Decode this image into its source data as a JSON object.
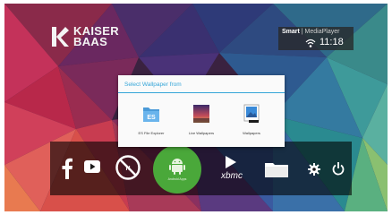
{
  "brand": {
    "logo_line1": "KAISER",
    "logo_line2": "BAAS"
  },
  "status": {
    "brand_bold": "Smart",
    "brand_rest": "| MediaPlayer",
    "time": "11:18"
  },
  "dialog": {
    "title": "Select Wallpaper from",
    "options": [
      {
        "label": "ES File Explorer",
        "icon": "es-file-explorer-icon"
      },
      {
        "label": "Live Wallpapers",
        "icon": "live-wallpapers-icon"
      },
      {
        "label": "Wallpapers",
        "icon": "wallpapers-icon"
      }
    ]
  },
  "dock": {
    "items": [
      {
        "icon": "facebook-icon"
      },
      {
        "icon": "youtube-icon"
      },
      {
        "icon": "no-netflix-icon"
      },
      {
        "icon": "android-apps-icon",
        "label": "Android Apps"
      },
      {
        "icon": "xbmc-icon",
        "label": "xbmc"
      },
      {
        "icon": "folder-icon"
      },
      {
        "icon": "settings-gear-icon"
      },
      {
        "icon": "power-icon"
      }
    ]
  },
  "colors": {
    "dialog_accent": "#35a5d8",
    "android_green": "#4aa83a"
  }
}
